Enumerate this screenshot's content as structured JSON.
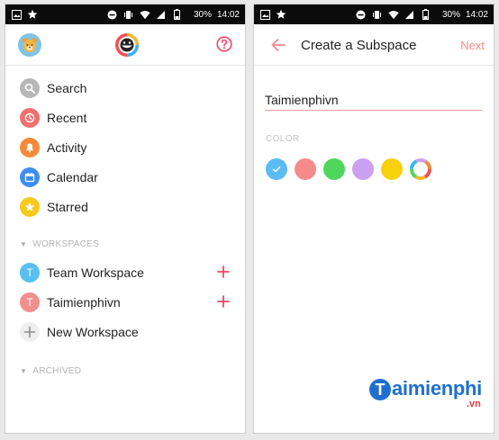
{
  "status_bar": {
    "battery": "30%",
    "time": "14:02"
  },
  "left": {
    "nav": [
      {
        "label": "Search",
        "icon": "search-icon",
        "color": "#b7b7b7"
      },
      {
        "label": "Recent",
        "icon": "clock-icon",
        "color": "#f16f6f"
      },
      {
        "label": "Activity",
        "icon": "bell-icon",
        "color": "#f58a3a"
      },
      {
        "label": "Calendar",
        "icon": "calendar-icon",
        "color": "#3c8ef0"
      },
      {
        "label": "Starred",
        "icon": "star-icon",
        "color": "#f7c91a"
      }
    ],
    "workspaces_header": "WORKSPACES",
    "workspaces": [
      {
        "initial": "T",
        "label": "Team Workspace",
        "color": "#58bff0"
      },
      {
        "initial": "T",
        "label": "Taimienphivn",
        "color": "#f18f8f"
      }
    ],
    "new_workspace": "New Workspace",
    "archived_header": "ARCHIVED"
  },
  "right": {
    "title": "Create a Subspace",
    "next_label": "Next",
    "name_value": "Taimienphivn",
    "color_label": "COLOR",
    "colors": [
      "#5bbcf3",
      "#f48b8b",
      "#4fd65c",
      "#c9a0f2",
      "#f6d10c",
      "multicolor"
    ]
  },
  "watermark": {
    "brand": "aimienphi",
    "initial": "T",
    "suffix": ".vn"
  },
  "accent": "#f2456a"
}
